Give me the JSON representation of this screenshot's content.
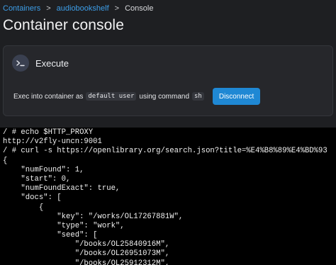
{
  "breadcrumb": {
    "items": [
      "Containers",
      "audiobookshelf",
      "Console"
    ],
    "separator": ">"
  },
  "page_title": "Container console",
  "execute_card": {
    "icon": "terminal-icon",
    "title": "Execute",
    "exec_prefix": "Exec into container as",
    "user": "default user",
    "using_command": "using command",
    "command": "sh",
    "disconnect_label": "Disconnect"
  },
  "terminal": {
    "lines": [
      "/ # echo $HTTP_PROXY",
      "http://v2fly-uncn:9001",
      "/ # curl -s https://openlibrary.org/search.json?title=%E4%B8%89%E4%BD%93",
      "{",
      "    \"numFound\": 1,",
      "    \"start\": 0,",
      "    \"numFoundExact\": true,",
      "    \"docs\": [",
      "        {",
      "            \"key\": \"/works/OL17267881W\",",
      "            \"type\": \"work\",",
      "            \"seed\": [",
      "                \"/books/OL25840916M\",",
      "                \"/books/OL26951073M\",",
      "                \"/books/OL25912312M\","
    ]
  },
  "colors": {
    "background": "#1e1f22",
    "card": "#26272b",
    "link": "#3d9ee8",
    "button": "#1f88d4",
    "terminal_bg": "#000000"
  }
}
